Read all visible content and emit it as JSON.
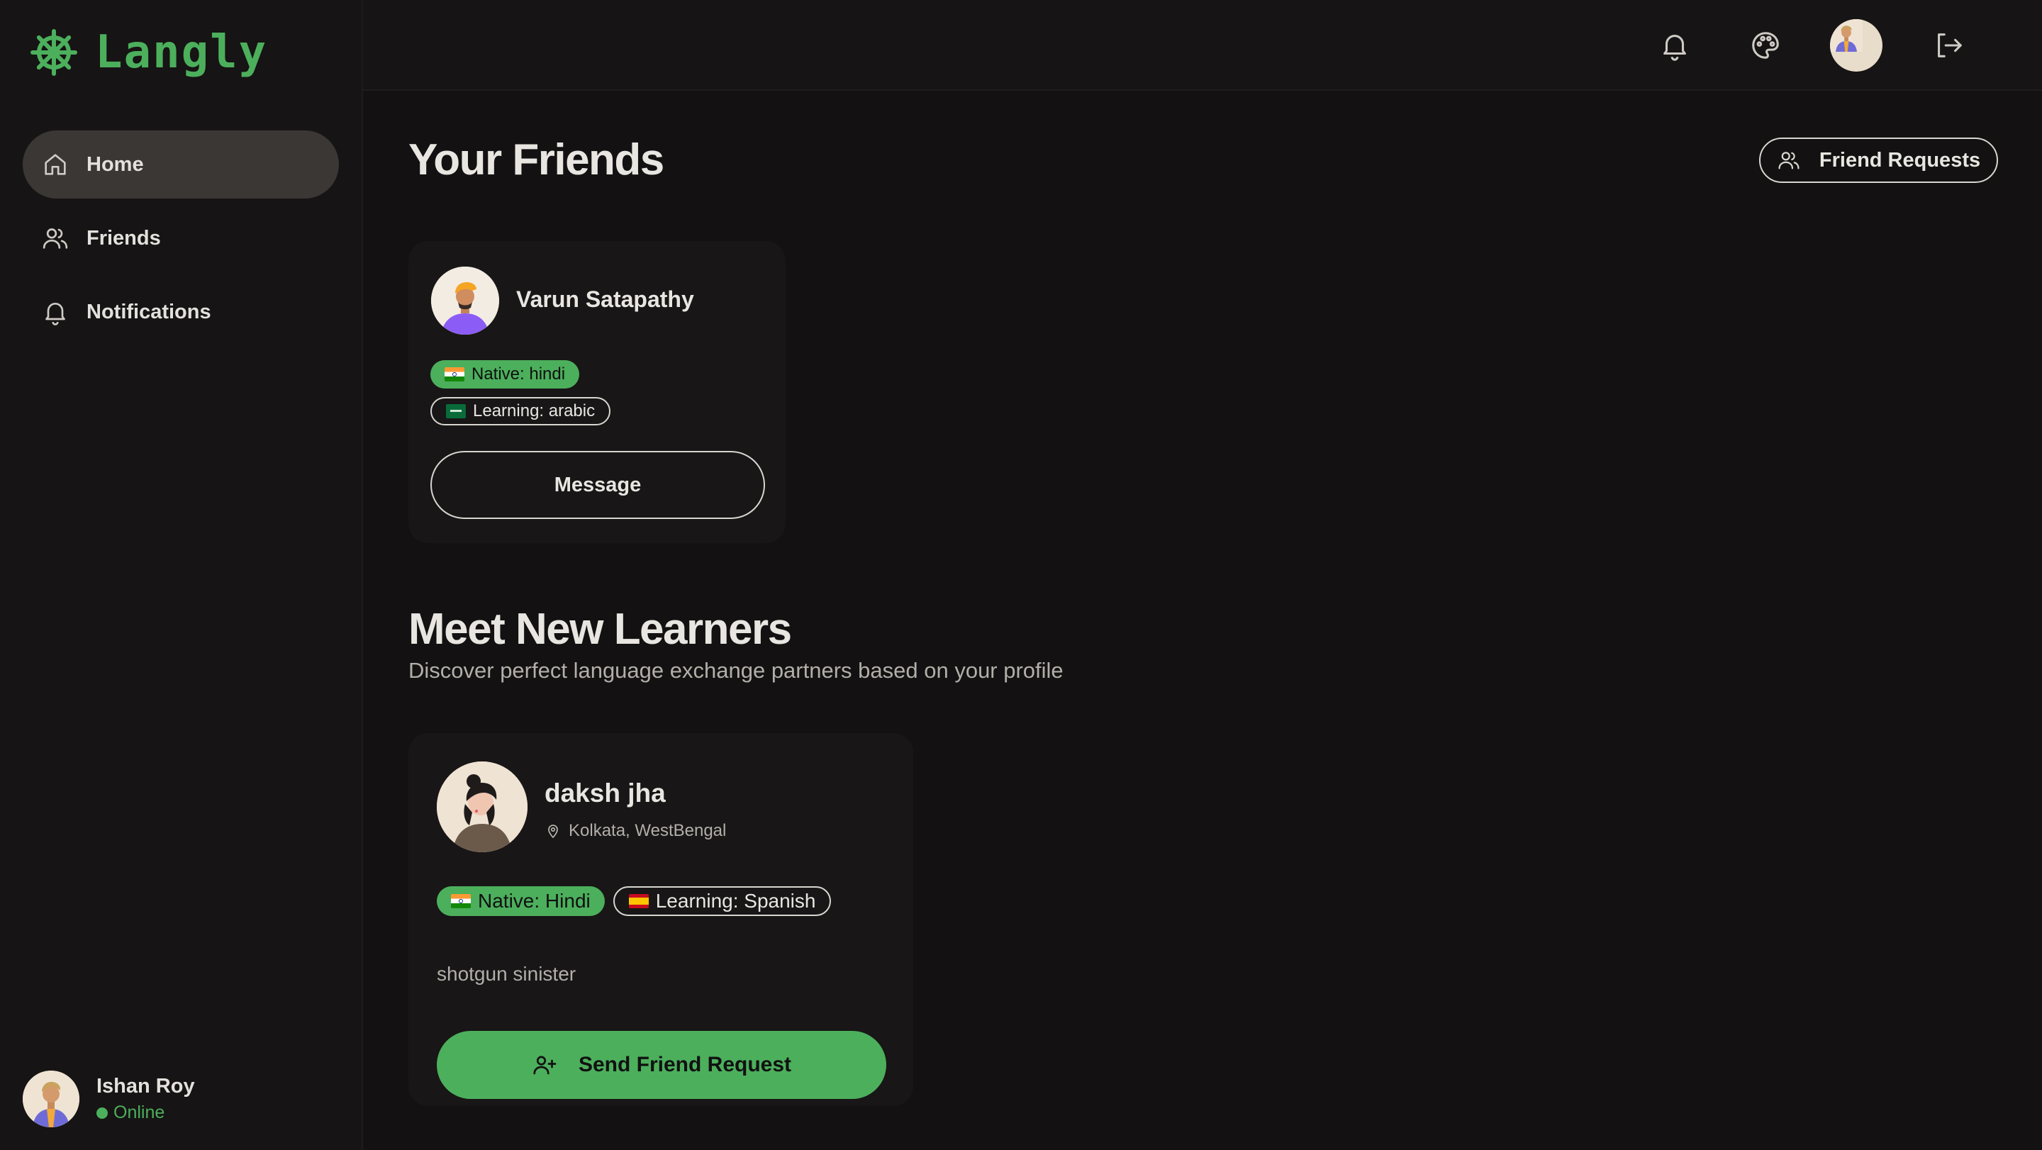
{
  "app": {
    "name": "Langly"
  },
  "sidebar": {
    "items": [
      {
        "label": "Home",
        "icon": "home-icon",
        "active": true
      },
      {
        "label": "Friends",
        "icon": "users-icon",
        "active": false
      },
      {
        "label": "Notifications",
        "icon": "bell-icon",
        "active": false
      }
    ],
    "user": {
      "name": "Ishan Roy",
      "status": "Online"
    }
  },
  "topbar": {
    "icons": [
      "bell-icon",
      "palette-icon",
      "avatar",
      "logout-icon"
    ]
  },
  "friends_section": {
    "title": "Your Friends",
    "friend_requests_label": "Friend Requests",
    "friends": [
      {
        "name": "Varun Satapathy",
        "native": "Native: hindi",
        "learning": "Learning: arabic",
        "message_label": "Message"
      }
    ]
  },
  "learners_section": {
    "title": "Meet New Learners",
    "subtitle": "Discover perfect language exchange partners based on your profile",
    "learners": [
      {
        "name": "daksh jha",
        "location": "Kolkata, WestBengal",
        "native": "Native: Hindi",
        "learning": "Learning: Spanish",
        "bio": "shotgun sinister",
        "action_label": "Send Friend Request"
      }
    ]
  },
  "colors": {
    "accent": "#4caf5c",
    "background": "#131111",
    "panel": "#161414",
    "card": "#181616"
  }
}
